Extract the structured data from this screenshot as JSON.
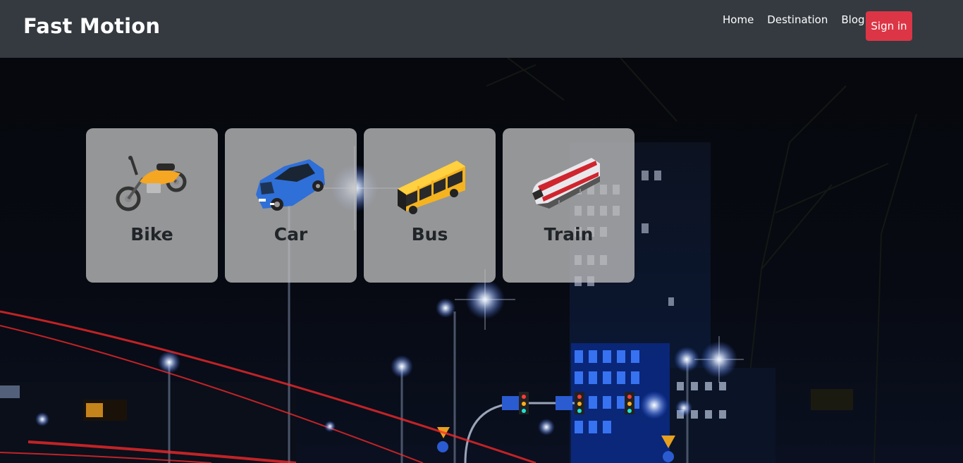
{
  "navbar": {
    "brand": "Fast Motion",
    "links": [
      "Home",
      "Destination",
      "Blog"
    ],
    "signin_label": "Sign in",
    "background": "#343a40",
    "signin_color": "#dc3545"
  },
  "cards": [
    {
      "label": "Bike",
      "icon": "motorcycle-icon"
    },
    {
      "label": "Car",
      "icon": "car-icon"
    },
    {
      "label": "Bus",
      "icon": "bus-icon"
    },
    {
      "label": "Train",
      "icon": "train-icon"
    }
  ]
}
